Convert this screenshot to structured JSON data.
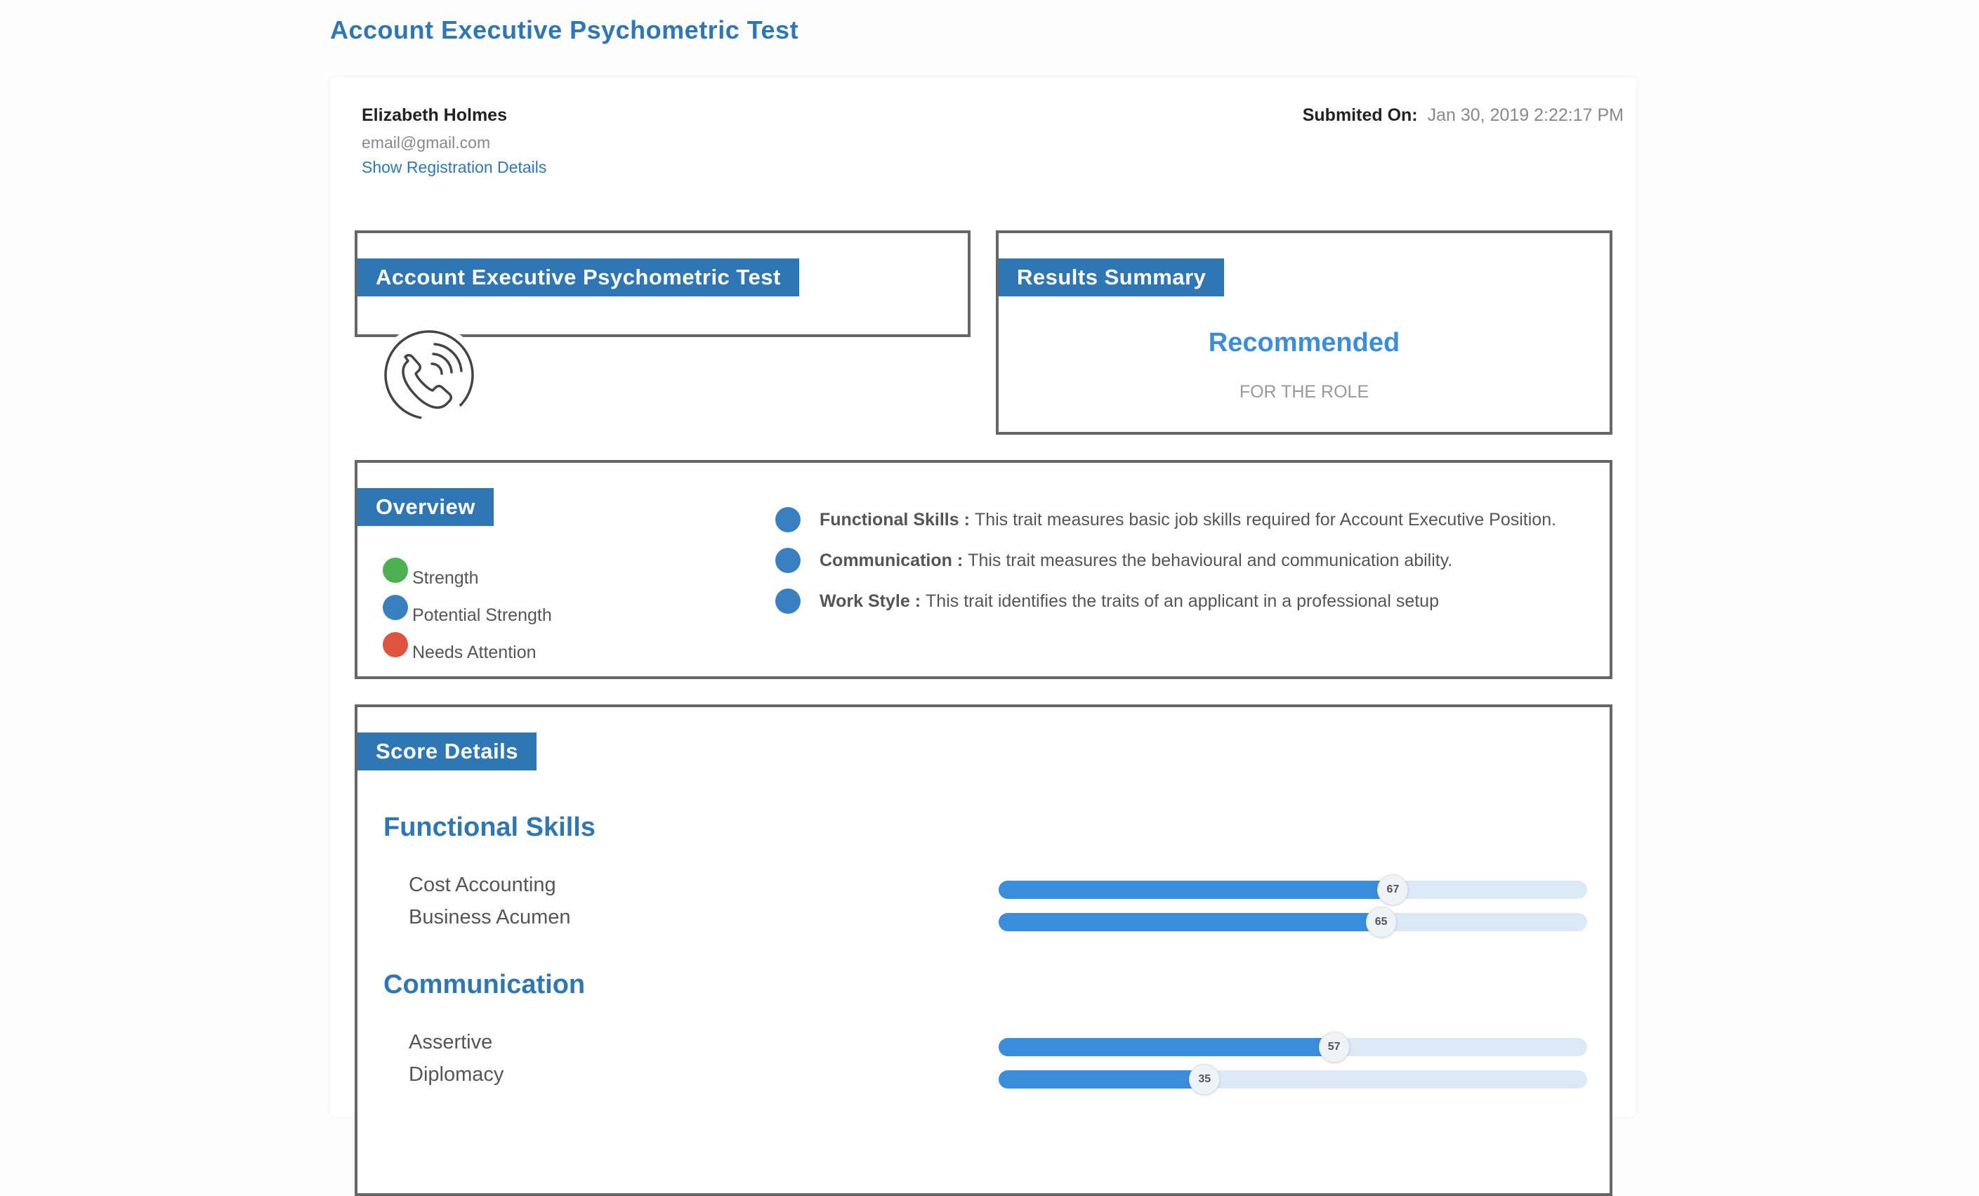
{
  "page_title": "Account Executive Psychometric Test",
  "candidate": {
    "name": "Elizabeth Holmes",
    "email": "email@gmail.com",
    "registration_link": "Show Registration Details",
    "submitted_label": "Submited On:",
    "submitted_value": "Jan 30, 2019 2:22:17 PM"
  },
  "test_box": {
    "tag": "Account Executive Psychometric Test",
    "icon": "phone-call-icon"
  },
  "results": {
    "tag": "Results Summary",
    "verdict": "Recommended",
    "subtext": "FOR THE ROLE"
  },
  "overview": {
    "tag": "Overview",
    "legend": [
      {
        "label": "Strength",
        "color": "#4caf50"
      },
      {
        "label": "Potential Strength",
        "color": "#3a80c0"
      },
      {
        "label": "Needs Attention",
        "color": "#e0533f"
      }
    ],
    "traits": [
      {
        "name": "Functional Skills :",
        "desc": "This trait measures basic job skills required for Account Executive Position.",
        "color": "#3a80c0"
      },
      {
        "name": "Communication :",
        "desc": "This trait measures the behavioural and communication ability.",
        "color": "#3a80c0"
      },
      {
        "name": "Work Style :",
        "desc": "This trait identifies the traits of an applicant in a professional setup",
        "color": "#3a80c0"
      }
    ]
  },
  "score_details": {
    "tag": "Score Details",
    "sections": [
      {
        "title": "Functional Skills",
        "items": [
          {
            "label": "Cost Accounting",
            "score": 67
          },
          {
            "label": "Business Acumen",
            "score": 65
          }
        ]
      },
      {
        "title": "Communication",
        "items": [
          {
            "label": "Assertive",
            "score": 57
          },
          {
            "label": "Diplomacy",
            "score": 35
          }
        ]
      }
    ],
    "max_score": 100
  },
  "colors": {
    "accent": "#2f76b5",
    "bar_fill": "#3a8ddb",
    "bar_track": "#dbe8f5"
  }
}
